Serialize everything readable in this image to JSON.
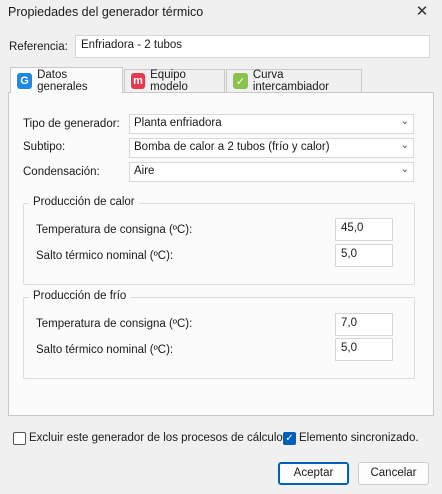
{
  "window": {
    "title": "Propiedades del generador térmico",
    "close_glyph": "✕"
  },
  "referencia": {
    "label": "Referencia:",
    "value": "Enfriadora - 2 tubos"
  },
  "tabs": [
    {
      "label": "Datos generales",
      "icon": "g-icon",
      "icon_glyph": "G",
      "icon_color": "#1e88e5",
      "selected": true
    },
    {
      "label": "Equipo modelo",
      "icon": "m-icon",
      "icon_glyph": "m",
      "icon_color": "#e53950",
      "selected": false
    },
    {
      "label": "Curva intercambiador",
      "icon": "curve-icon",
      "icon_glyph": "✓",
      "icon_color": "#8bc34a",
      "selected": false
    }
  ],
  "general": {
    "tipo": {
      "label": "Tipo de generador:",
      "value": "Planta enfriadora"
    },
    "subtipo": {
      "label": "Subtipo:",
      "value": "Bomba de calor a 2 tubos (frío y calor)"
    },
    "condensacion": {
      "label": "Condensación:",
      "value": "Aire"
    }
  },
  "calor": {
    "title": "Producción de calor",
    "consigna_label": "Temperatura de consigna (ºC):",
    "consigna_value": "45,0",
    "salto_label": "Salto térmico nominal (ºC):",
    "salto_value": "5,0"
  },
  "frio": {
    "title": "Producción de frío",
    "consigna_label": "Temperatura de consigna (ºC):",
    "consigna_value": "7,0",
    "salto_label": "Salto térmico nominal (ºC):",
    "salto_value": "5,0"
  },
  "footer": {
    "excluir_label": "Excluir este generador de los procesos de cálculo.",
    "excluir_checked": false,
    "sincronizado_label": "Elemento sincronizado.",
    "sincronizado_checked": true,
    "check_glyph": "✓",
    "chevron_glyph": "⌄",
    "accept_label": "Aceptar",
    "cancel_label": "Cancelar"
  },
  "colors": {
    "accent": "#005fb8"
  }
}
